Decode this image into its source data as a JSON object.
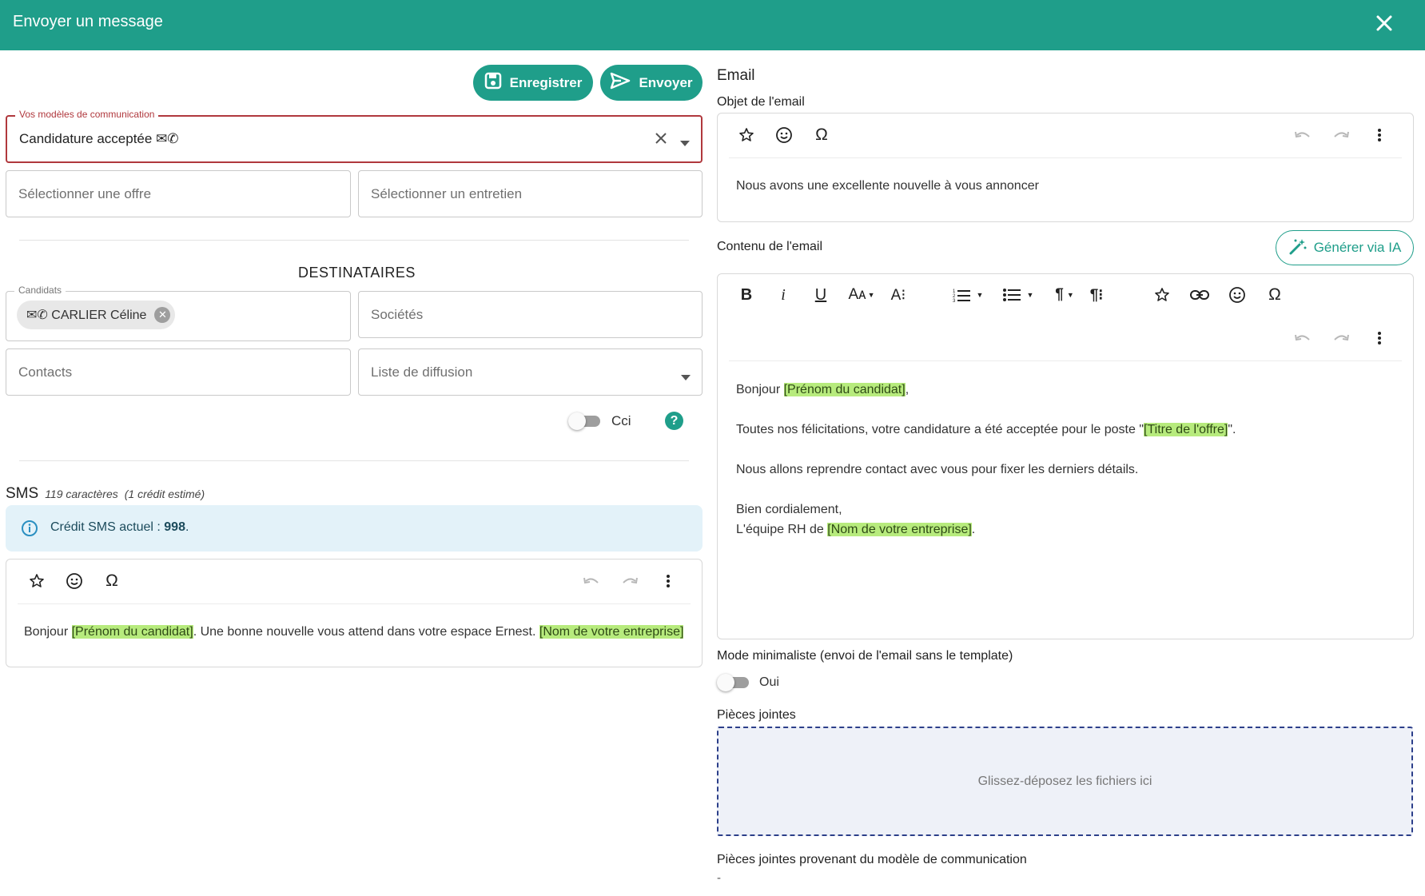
{
  "dialog": {
    "title": "Envoyer un message"
  },
  "actions": {
    "save_label": "Enregistrer",
    "send_label": "Envoyer"
  },
  "template_field": {
    "legend": "Vos modèles de communication",
    "value": "Candidature acceptée ✉✆"
  },
  "offer_field": {
    "placeholder": "Sélectionner une offre"
  },
  "interview_field": {
    "placeholder": "Sélectionner un entretien"
  },
  "recipients": {
    "heading": "DESTINATAIRES",
    "candidates_legend": "Candidats",
    "candidate_chip": "✉✆ CARLIER Céline",
    "companies_placeholder": "Sociétés",
    "contacts_placeholder": "Contacts",
    "mailing_list_placeholder": "Liste de diffusion",
    "bcc_label": "Cci",
    "help": "?"
  },
  "sms": {
    "title": "SMS",
    "count": "119 caractères",
    "credits_estimate": "(1 crédit estimé)",
    "credit_label": "Crédit SMS actuel : ",
    "credit_value": "998",
    "credit_suffix": ".",
    "text_1": "Bonjour ",
    "var_1": "Prénom du candidat",
    "text_2": ". Une bonne nouvelle vous attend dans votre espace Ernest. ",
    "var_2": "Nom de votre entreprise"
  },
  "email": {
    "section_title": "Email",
    "subject_label": "Objet de l'email",
    "subject_value": "Nous avons une excellente nouvelle à vous annoncer",
    "content_label": "Contenu de l'email",
    "ai_button": "Générer via IA",
    "body": {
      "greeting": "Bonjour ",
      "var_firstname": "Prénom du candidat",
      "greeting_end": ",",
      "line2_start": "Toutes nos félicitations, votre candidature a été acceptée pour le poste \"",
      "var_offer_title": "Titre de l'offre",
      "line2_end": "\".",
      "line3": "Nous allons reprendre contact avec vous pour fixer les derniers détails.",
      "line4": "Bien cordialement,",
      "line5_start": "L'équipe RH de ",
      "var_company": "Nom de votre entreprise",
      "line5_end": "."
    },
    "minimal_mode_label": "Mode minimaliste (envoi de l'email sans le template)",
    "minimal_mode_toggle_label": "Oui",
    "attachments_label": "Pièces jointes",
    "dropzone_text": "Glissez-déposez les fichiers ici",
    "template_attachments_label": "Pièces jointes provenant du modèle de communication",
    "template_attachments_value": "-"
  },
  "colors": {
    "primary": "#1f9e8a",
    "error": "#b0383d",
    "highlight": "#b7eb7d",
    "info_bg": "#e3f2f9"
  }
}
